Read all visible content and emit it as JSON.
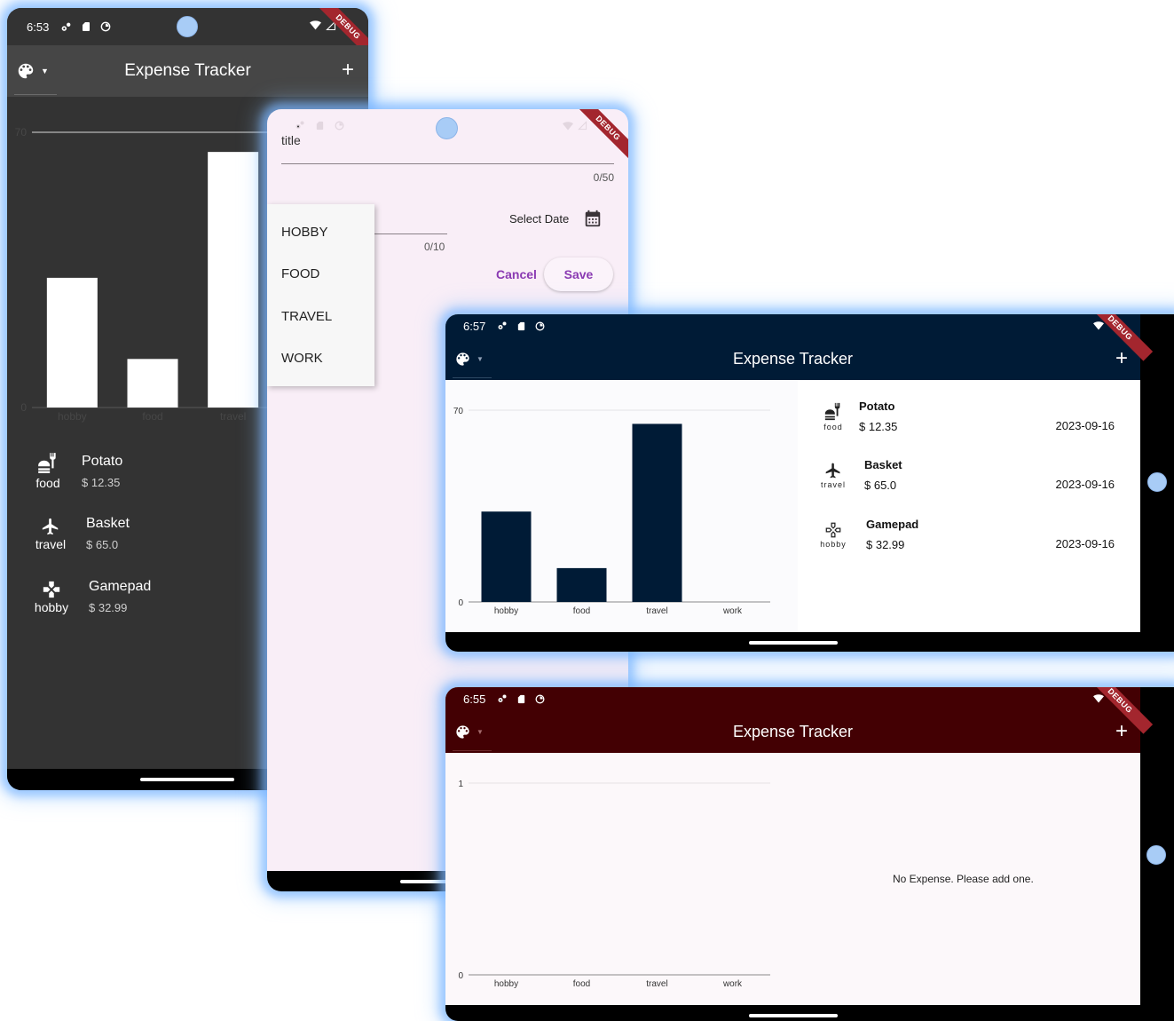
{
  "phone_dark": {
    "status": {
      "time": "6:53"
    },
    "debug_label": "DEBUG",
    "appbar": {
      "title": "Expense Tracker"
    },
    "chart_data": {
      "type": "bar",
      "categories": [
        "hobby",
        "food",
        "travel"
      ],
      "values": [
        32.99,
        12.35,
        65.0
      ],
      "ylim": [
        0,
        70
      ],
      "yticks": [
        "0",
        "70"
      ],
      "grid": true
    },
    "expenses": [
      {
        "category": "food",
        "title": "Potato",
        "amount": "$ 12.35"
      },
      {
        "category": "travel",
        "title": "Basket",
        "amount": "$ 65.0"
      },
      {
        "category": "hobby",
        "title": "Gamepad",
        "amount": "$ 32.99"
      }
    ]
  },
  "phone_form": {
    "debug_label": "DEBUG",
    "title_field": {
      "label": "title",
      "counter": "0/50"
    },
    "amount_field": {
      "counter": "0/10"
    },
    "select_date_label": "Select Date",
    "cancel_label": "Cancel",
    "save_label": "Save",
    "dropdown": [
      "HOBBY",
      "FOOD",
      "TRAVEL",
      "WORK"
    ]
  },
  "tablet_navy": {
    "status": {
      "time": "6:57"
    },
    "debug_label": "DEBUG",
    "appbar": {
      "title": "Expense Tracker",
      "color": "#001b36"
    },
    "chart_data": {
      "type": "bar",
      "categories": [
        "hobby",
        "food",
        "travel",
        "work"
      ],
      "values": [
        32.99,
        12.35,
        65.0,
        0
      ],
      "ylim": [
        0,
        70
      ],
      "yticks": [
        "0",
        "70"
      ],
      "grid": true
    },
    "expenses": [
      {
        "category": "food",
        "title": "Potato",
        "amount": "$ 12.35",
        "date": "2023-09-16"
      },
      {
        "category": "travel",
        "title": "Basket",
        "amount": "$ 65.0",
        "date": "2023-09-16"
      },
      {
        "category": "hobby",
        "title": "Gamepad",
        "amount": "$ 32.99",
        "date": "2023-09-16"
      }
    ]
  },
  "tablet_maroon": {
    "status": {
      "time": "6:55"
    },
    "debug_label": "DEBUG",
    "appbar": {
      "title": "Expense Tracker",
      "color": "#430003"
    },
    "chart_data": {
      "type": "bar",
      "categories": [
        "hobby",
        "food",
        "travel",
        "work"
      ],
      "values": [
        0,
        0,
        0,
        0
      ],
      "ylim": [
        0,
        1
      ],
      "yticks": [
        "0",
        "1"
      ],
      "grid": true
    },
    "empty_message": "No Expense. Please add one."
  }
}
